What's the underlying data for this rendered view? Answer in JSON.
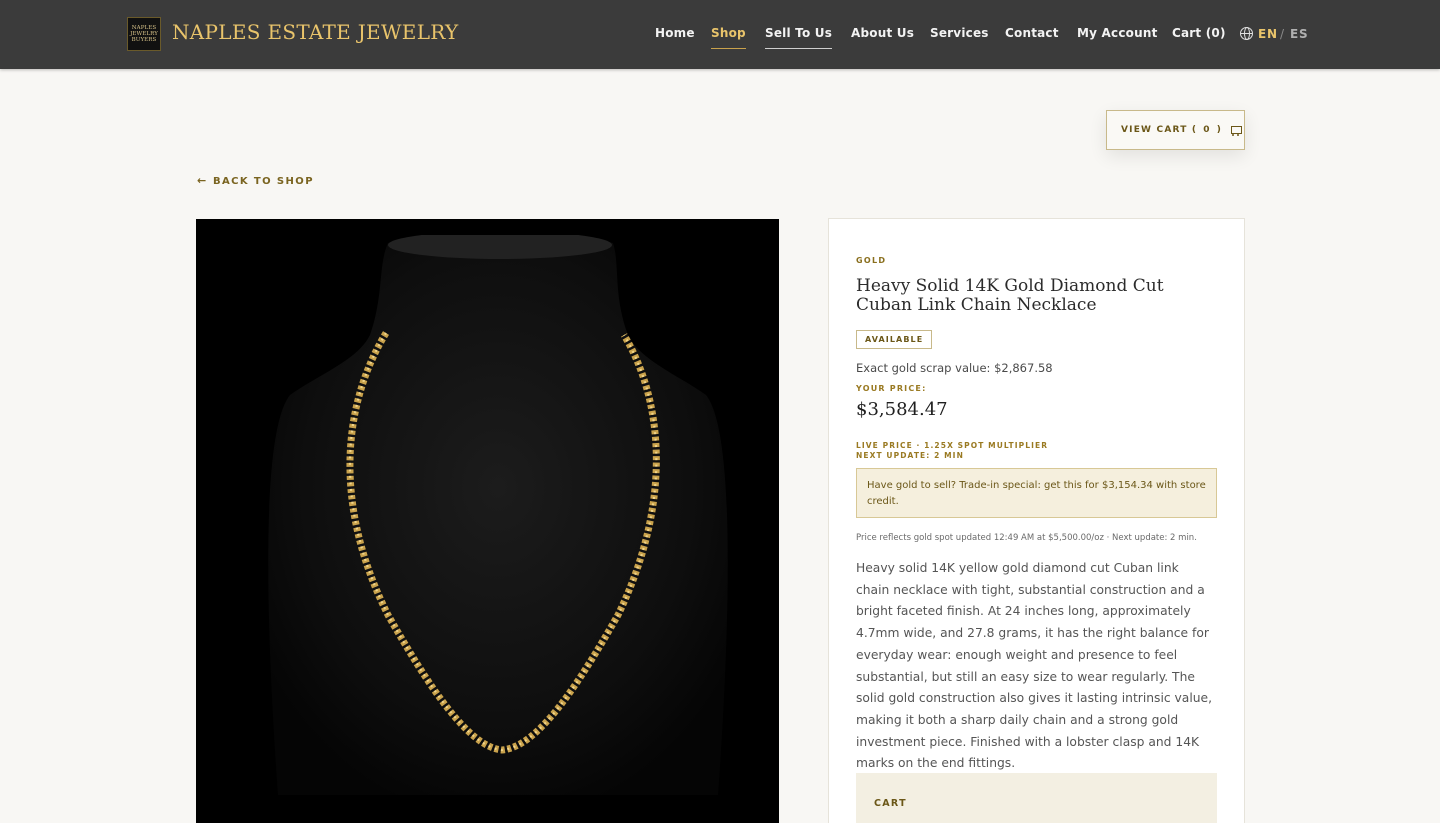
{
  "header": {
    "logo_lines": [
      "NAPLES",
      "JEWELRY",
      "BUYERS"
    ],
    "brand": "NAPLES ESTATE JEWELRY",
    "nav": [
      {
        "label": "Home"
      },
      {
        "label": "Shop"
      },
      {
        "label": "Sell To Us"
      },
      {
        "label": "About Us"
      },
      {
        "label": "Services"
      },
      {
        "label": "Contact"
      },
      {
        "label": "My Account"
      },
      {
        "label": "Cart (0)"
      }
    ],
    "lang_active": "EN",
    "lang_sep": "/",
    "lang_other": "ES"
  },
  "view_cart": {
    "label": "VIEW CART (",
    "count": "0",
    "close": ")"
  },
  "back_link": {
    "arrow": "←",
    "label": "BACK TO SHOP"
  },
  "product": {
    "category": "GOLD",
    "title": "Heavy Solid 14K Gold Diamond Cut Cuban Link Chain Necklace",
    "badge": "AVAILABLE",
    "scrap_value": "Exact gold scrap value: $2,867.58",
    "your_price_label": "YOUR PRICE:",
    "price": "$3,584.47",
    "live_price": "LIVE PRICE · 1.25X SPOT MULTIPLIER",
    "next_update": "NEXT UPDATE: 2 MIN",
    "trade_in": "Have gold to sell? Trade-in special: get this for $3,154.34 with store credit.",
    "price_note": "Price reflects gold spot updated 12:49 AM at $5,500.00/oz · Next update: 2 min.",
    "description": "Heavy solid 14K yellow gold diamond cut Cuban link chain necklace with tight, substantial construction and a bright faceted finish. At 24 inches long, approximately 4.7mm wide, and 27.8 grams, it has the right balance for everyday wear: enough weight and presence to feel substantial, but still an easy size to wear regularly. The solid gold construction also gives it lasting intrinsic value, making it both a sharp daily chain and a strong gold investment piece. Finished with a lobster clasp and 14K marks on the end fittings.",
    "cart_section": "CART"
  },
  "colors": {
    "header_bg": "#3b3b3b",
    "gold_accent": "#e9c46b",
    "page_bg": "#f8f7f4"
  }
}
